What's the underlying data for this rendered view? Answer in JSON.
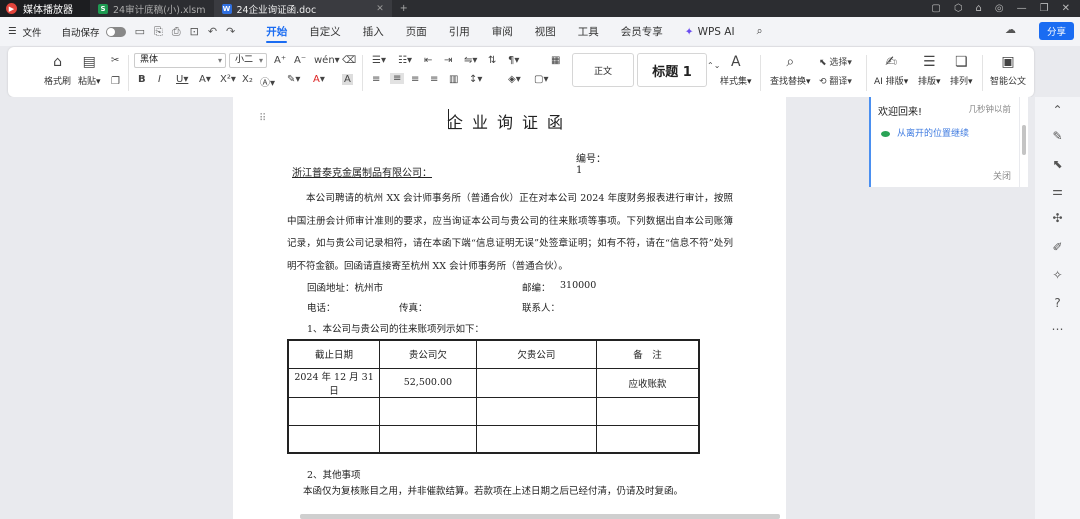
{
  "titlebar": {
    "app_name": "媒体播放器",
    "tabs": [
      {
        "label": "24审计底稿(小).xlsm",
        "badge": "S",
        "color": "#1e9b52"
      },
      {
        "label": "24企业询证函.doc",
        "badge": "W",
        "color": "#2f6fe0"
      }
    ],
    "new_tab": "+",
    "right_icons": [
      "▢",
      "⬡",
      "⌂",
      "◎",
      "—",
      "❐",
      "✕"
    ]
  },
  "menu": {
    "file": "文件",
    "autosave": "自动保存",
    "tabs": [
      "开始",
      "自定义",
      "插入",
      "页面",
      "引用",
      "审阅",
      "视图",
      "工具",
      "会员专享"
    ],
    "active_tab": "开始",
    "wps_ai": "WPS AI",
    "share": "分享"
  },
  "toolbar": {
    "format_painter": "格式刷",
    "paste": "粘贴",
    "font_name": "黑体",
    "font_size": "小二",
    "style_normal": "正文",
    "style_heading": "标题 1",
    "styles_set": "样式集",
    "find_replace": "查找替换",
    "select": "选择",
    "translate": "翻译",
    "ai_layout": "AI 排版",
    "layout": "排版",
    "arrange": "排列",
    "smart_doc": "智能公文"
  },
  "document": {
    "title": "企业询证函",
    "number": "编号：1",
    "addressee": "浙江普泰克金属制品有限公司：",
    "body": "本公司聘请的杭州 XX 会计师事务所（普通合伙）正在对本公司 2024 年度财务报表进行审计，按照中国注册会计师审计准则的要求，应当询证本公司与贵公司的往来账项等事项。下列数据出自本公司账簿记录，如与贵公司记录相符，请在本函下端“信息证明无误”处签章证明；如有不符，请在“信息不符”处列明不符金额。回函请直接寄至杭州 XX 会计师事务所（普通合伙）。",
    "address_label": "回函地址：杭州市",
    "postcode_label": "邮编：",
    "postcode": "310000",
    "phone_label": "电话：",
    "fax_label": "传真：",
    "contact_label": "联系人：",
    "section1": "1、本公司与贵公司的往来账项列示如下：",
    "table": {
      "headers": [
        "截止日期",
        "贵公司欠",
        "欠贵公司",
        "备　注"
      ],
      "rows": [
        [
          "2024 年 12 月 31 日",
          "52,500.00",
          "",
          "应收账款"
        ],
        [
          "",
          "",
          "",
          ""
        ],
        [
          "",
          "",
          "",
          ""
        ]
      ]
    },
    "section2": "2、其他事项",
    "section2_text": "本函仅为复核账目之用，并非催款结算。若款项在上述日期之后已经付清，仍请及时复函。"
  },
  "welcome_panel": {
    "title": "欢迎回来!",
    "time": "几秒钟以前",
    "link": "从离开的位置继续",
    "close": "关闭"
  }
}
